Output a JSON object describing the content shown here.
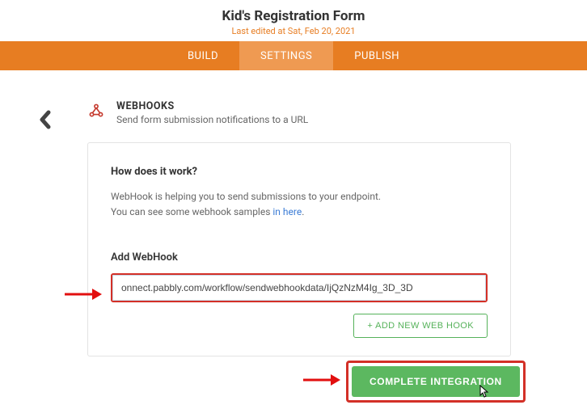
{
  "header": {
    "title": "Kid's Registration Form",
    "last_edited": "Last edited at Sat, Feb 20, 2021"
  },
  "tabs": {
    "build": "BUILD",
    "settings": "SETTINGS",
    "publish": "PUBLISH"
  },
  "section": {
    "title": "WEBHOOKS",
    "subtitle": "Send form submission notifications to a URL"
  },
  "panel": {
    "how_title": "How does it work?",
    "how_line1": "WebHook is helping you to send submissions to your endpoint.",
    "how_line2_pre": "You can see some webhook samples ",
    "how_line2_link": "in here",
    "how_line2_post": ".",
    "add_title": "Add WebHook",
    "url_value": "onnect.pabbly.com/workflow/sendwebhookdata/IjQzNzM4Ig_3D_3D",
    "add_button": "+ ADD NEW WEB HOOK"
  },
  "footer": {
    "complete_button": "COMPLETE INTEGRATION"
  }
}
